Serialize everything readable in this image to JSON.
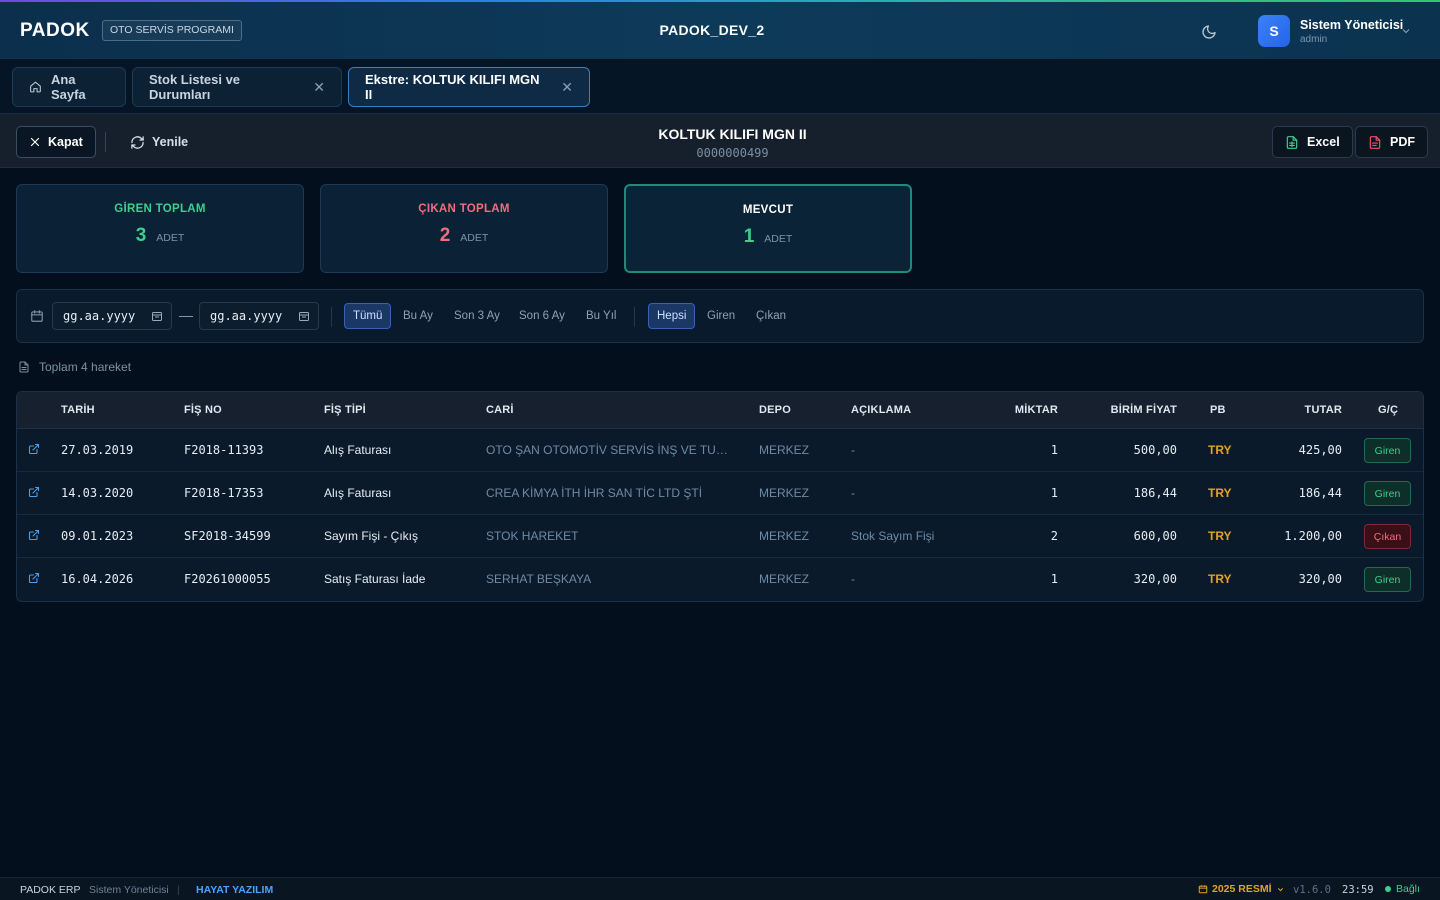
{
  "header": {
    "logo": "PADOK",
    "badge": "OTO SERVİS PROGRAMI",
    "app_title": "PADOK_DEV_2",
    "user_initial": "S",
    "user_name": "Sistem Yöneticisi",
    "user_role": "admin"
  },
  "tabs": [
    {
      "label": "Ana Sayfa"
    },
    {
      "label": "Stok Listesi ve Durumları"
    },
    {
      "label": "Ekstre: KOLTUK KILIFI MGN II"
    }
  ],
  "toolbar": {
    "close_label": "Kapat",
    "refresh_label": "Yenile",
    "item_name": "KOLTUK KILIFI MGN II",
    "item_code": "0000000499",
    "excel_label": "Excel",
    "pdf_label": "PDF"
  },
  "summary": {
    "in": {
      "label": "GİREN TOPLAM",
      "value": "3",
      "unit": "ADET"
    },
    "out": {
      "label": "ÇIKAN TOPLAM",
      "value": "2",
      "unit": "ADET"
    },
    "current": {
      "label": "MEVCUT",
      "value": "1",
      "unit": "ADET"
    }
  },
  "filters": {
    "date_from": "gg.aa.yyyy",
    "date_to": "gg.aa.yyyy",
    "periods": [
      "Tümü",
      "Bu Ay",
      "Son 3 Ay",
      "Son 6 Ay",
      "Bu Yıl"
    ],
    "directions": [
      "Hepsi",
      "Giren",
      "Çıkan"
    ],
    "selected_period": "Tümü",
    "selected_direction": "Hepsi"
  },
  "total_info": "Toplam 4 hareket",
  "table": {
    "columns": [
      "TARİH",
      "FİŞ NO",
      "FİŞ TİPİ",
      "CARİ",
      "DEPO",
      "AÇIKLAMA",
      "MİKTAR",
      "BİRİM FİYAT",
      "PB",
      "TUTAR",
      "G/Ç"
    ],
    "rows": [
      {
        "date": "27.03.2019",
        "fis_no": "F2018-11393",
        "fis_tipi": "Alış Faturası",
        "cari": "OTO ŞAN OTOMOTİV SERVİS İNŞ VE TUR SA...",
        "depo": "MERKEZ",
        "aciklama": "-",
        "miktar": "1",
        "birim_fiyat": "500,00",
        "pb": "TRY",
        "tutar": "425,00",
        "gc": "Giren"
      },
      {
        "date": "14.03.2020",
        "fis_no": "F2018-17353",
        "fis_tipi": "Alış Faturası",
        "cari": "CREA KİMYA İTH İHR SAN TİC LTD ŞTİ",
        "depo": "MERKEZ",
        "aciklama": "-",
        "miktar": "1",
        "birim_fiyat": "186,44",
        "pb": "TRY",
        "tutar": "186,44",
        "gc": "Giren"
      },
      {
        "date": "09.01.2023",
        "fis_no": "SF2018-34599",
        "fis_tipi": "Sayım Fişi - Çıkış",
        "cari": "STOK HAREKET",
        "depo": "MERKEZ",
        "aciklama": "Stok Sayım Fişi",
        "miktar": "2",
        "birim_fiyat": "600,00",
        "pb": "TRY",
        "tutar": "1.200,00",
        "gc": "Çıkan"
      },
      {
        "date": "16.04.2026",
        "fis_no": "F20261000055",
        "fis_tipi": "Satış Faturası İade",
        "cari": "SERHAT BEŞKAYA",
        "depo": "MERKEZ",
        "aciklama": "-",
        "miktar": "1",
        "birim_fiyat": "320,00",
        "pb": "TRY",
        "tutar": "320,00",
        "gc": "Giren"
      }
    ]
  },
  "status": {
    "app": "PADOK ERP",
    "user": "Sistem Yöneticisi",
    "company": "HAYAT YAZILIM",
    "period": "2025 RESMİ",
    "version": "v1.6.0",
    "time": "23:59",
    "connection": "Bağlı"
  },
  "colors": {
    "accent": "#3a7fbf",
    "in_green": "#3ecf8e",
    "out_red": "#f26d7d",
    "currency": "#e0a425"
  }
}
